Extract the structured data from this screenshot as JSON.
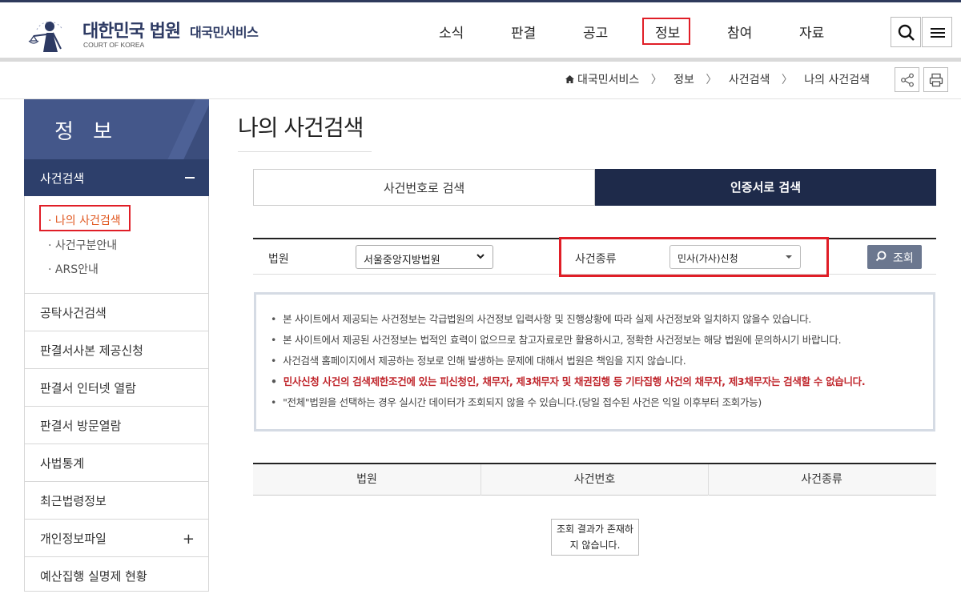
{
  "header": {
    "logo_title": "대한민국 법원",
    "logo_subtitle": "COURT OF KOREA",
    "service_name": "대국민서비스",
    "nav": [
      "소식",
      "판결",
      "공고",
      "정보",
      "참여",
      "자료"
    ],
    "active_nav": "정보"
  },
  "breadcrumb": [
    "대국민서비스",
    "정보",
    "사건검색",
    "나의 사건검색"
  ],
  "sidebar": {
    "title": "정 보",
    "active_section": "사건검색",
    "sub_items": [
      "나의 사건검색",
      "사건구분안내",
      "ARS안내"
    ],
    "menu": [
      "공탁사건검색",
      "판결서사본 제공신청",
      "판결서 인터넷 열람",
      "판결서 방문열람",
      "사법통계",
      "최근법령정보",
      "개인정보파일",
      "예산집행 실명제 현황"
    ]
  },
  "main": {
    "title": "나의 사건검색",
    "tabs": [
      "사건번호로 검색",
      "인증서로 검색"
    ],
    "active_tab": "인증서로 검색",
    "search": {
      "court_label": "법원",
      "court_value": "서울중앙지방법원",
      "type_label": "사건종류",
      "type_value": "민사(가사)신청",
      "button_label": "조회"
    },
    "notices": [
      "본 사이트에서 제공되는 사건정보는 각급법원의 사건정보 입력사항 및 진행상황에 따라 실제 사건정보와 일치하지 않을수 있습니다.",
      "본 사이트에서 제공된 사건정보는 법적인 효력이 없으므로 참고자료로만 활용하시고, 정확한 사건정보는 해당 법원에 문의하시기 바랍니다.",
      "사건검색 홈페이지에서 제공하는 정보로 인해 발생하는 문제에 대해서 법원은 책임을 지지 않습니다.",
      "민사신청 사건의 검색제한조건에 있는 피신청인, 채무자, 제3채무자 및 채권집행 등 기타집행 사건의 채무자, 제3채무자는 검색할 수 없습니다.",
      "\"전체\"법원을 선택하는 경우 실시간 데이터가 조회되지 않을 수 있습니다.(당일 접수된 사건은 익일 이후부터 조회가능)"
    ],
    "result_columns": [
      "법원",
      "사건번호",
      "사건종류"
    ],
    "empty_line1": "조회 결과가 존재하",
    "empty_line2": "지 않습니다."
  },
  "colors": {
    "brand_navy": "#1e2a4a",
    "sidebar_blue": "#44578a",
    "highlight_red": "#e01e27",
    "warning_text": "#c0272d"
  },
  "icons": [
    "court-emblem-icon",
    "search-icon",
    "menu-icon",
    "home-icon",
    "share-icon",
    "print-icon",
    "chevron-down-icon"
  ]
}
